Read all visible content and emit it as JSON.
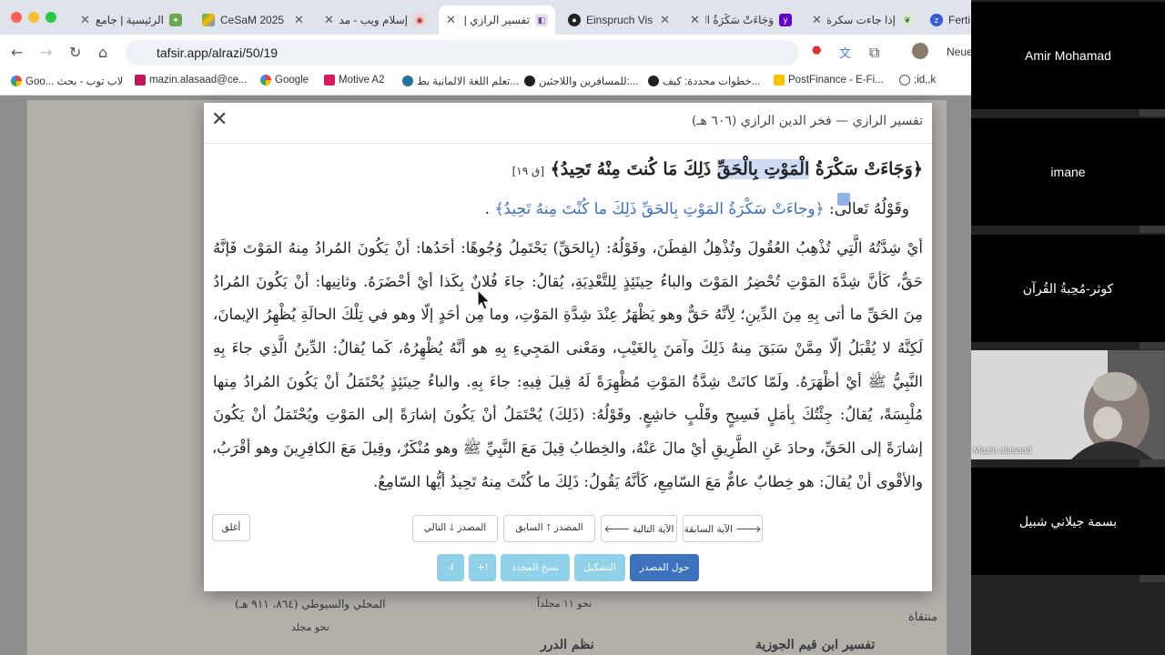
{
  "tabs": [
    {
      "title": "الرئيسية | جامع",
      "icon": "tab-icon-jami"
    },
    {
      "title": "CeSaM 2025",
      "icon": "google-drive-icon"
    },
    {
      "title": "إسلام ويب - مد",
      "icon": "islamweb-icon"
    },
    {
      "title": "تفسير الرازي | 9",
      "icon": "tafsir-icon"
    },
    {
      "title": "Einspruch Vis",
      "icon": "github-icon"
    },
    {
      "title": "وَجَاءَتْ سَكْرَةُ الْ",
      "icon": "yahoo-icon"
    },
    {
      "title": "إذا جاءت سكرة",
      "icon": "leaf-icon"
    },
    {
      "title": "Fertig",
      "icon": "zm-icon"
    }
  ],
  "address_bar": {
    "url": "tafsir.app/alrazi/50/19"
  },
  "profile": {
    "label": "Neue"
  },
  "bookmarks": [
    {
      "label": "Goo... لاب توب - بحث",
      "icon": "google-icon"
    },
    {
      "label": "mazin.alasaad@ce...",
      "icon": "bookmark-icon"
    },
    {
      "label": "Google",
      "icon": "google-icon"
    },
    {
      "label": "Motive A2",
      "icon": "motive-icon"
    },
    {
      "label": "تعلم اللغة الالمانية بط...",
      "icon": "wordpress-icon"
    },
    {
      "label": "للمسافرين واللاجئين:...",
      "icon": "g-icon"
    },
    {
      "label": "خطوات محددة: كيف...",
      "icon": "g-icon"
    },
    {
      "label": "PostFinance - E-Fi...",
      "icon": "postfinance-icon"
    },
    {
      "label": ";id,,k",
      "icon": "globe-icon"
    }
  ],
  "background_page": {
    "item1_title": "المحلي والسيوطي (٨٦٤، ٩١١ هـ)",
    "item1_sub": "نحو مجلد",
    "item2_sub": "نحو ١١ مجلداً",
    "item3_label": "منتقاة",
    "item4_title": "نظم الدرر",
    "item5_title": "تفسير ابن قيم الجوزية"
  },
  "modal": {
    "title": "تفسير الرازي — فخر الدين الرازي (٦٠٦ هـ)",
    "verse_before": "﴿وَجَاءَتْ سَكْرَةُ",
    "verse_highlight": "الْمَوْتِ بِالْحَقِّ",
    "verse_after": "ذَلِكَ مَا كُنتَ مِنْهُ تَحِيدُ﴾",
    "verse_ref": "[ق ١٩]",
    "quote_intro": "وقَوْلُهُ تَعالى:",
    "quote_verse": "﴿وجاءَتْ سَكْرَةُ المَوْتِ بِالحَقِّ ذَلِكَ ما كُنْتَ مِنهُ تَحِيدُ﴾",
    "quote_end": ".",
    "commentary_lines": [
      "أيْ شِدَّتُهُ الَّتِي تُذْهِبُ العُقُولَ وتُذْهِلُ الفِطَنَ، وقَوْلُهُ: (بِالحَقِّ) يَحْتَمِلُ وُجُوهًا: أحَدُها: أنْ يَكُونَ المُرادُ مِنهُ المَوْتَ فَإنَّهُ",
      "حَقٌّ، كَأنَّ شِدَّةَ المَوْتِ تُحْضِرُ المَوْتَ والباءُ حِينَئِذٍ لِلتَّعْدِيَةِ، يُقالُ: جاءَ فُلانٌ بِكَذا أيْ أحْضَرَهُ. وثانِيها: أنْ يَكُونَ المُرادُ",
      "مِنَ الحَقِّ ما أتى بِهِ مِنَ الدِّينِ؛ لِأنَّهُ حَقٌّ وهو يَظْهَرُ عِنْدَ شِدَّةِ المَوْتِ، وما مِن أحَدٍ إلّا وهو في تِلْكَ الحالَةِ يُظْهِرُ الإيمانَ،",
      "لَكِنَّهُ لا يُقْبَلُ إلّا مِمَّنْ سَبَقَ مِنهُ ذَلِكَ وآمَنَ بِالغَيْبِ، ومَعْنى المَجِيءِ بِهِ هو أنَّهُ يُظْهِرُهُ، كَما يُقالُ: الدِّينُ الَّذِي جاءَ بِهِ",
      "النَّبِيُّ ﷺ أيْ أظْهَرَهُ. ولَمّا كانَتْ شِدَّةُ المَوْتِ مُظْهِرَةً لَهُ قِيلَ فِيهِ: جاءَ بِهِ. والباءُ حِينَئِذٍ يُحْتَمَلُ أنْ يَكُونَ المُرادُ مِنها",
      "مُلْبِسَةً، يُقالُ: جِئْتُكَ بِأمَلٍ فَسِيحٍ وقَلْبٍ خاشِعٍ. وقَوْلُهُ: (ذَلِكَ) يُحْتَمَلُ أنْ يَكُونَ إشارَةً إلى المَوْتِ ويُحْتَمَلُ أنْ يَكُونَ",
      "إشارَةً إلى الحَقِّ، وحادَ عَنِ الطَّرِيقِ أيْ مالَ عَنْهُ، والخِطابُ قِيلَ مَعَ النَّبِيِّ ﷺ وهو مُنْكَرٌ، وقِيلَ مَعَ الكافِرِينَ وهو أقْرَبُ،",
      "والأقْوى أنْ يُقالَ: هو خِطابٌ عامٌّ مَعَ السّامِعِ، كَأنَّهُ يَقُولُ: ذَلِكَ ما كُنْتَ مِنهُ تَحِيدُ أيُّها السّامِعُ."
    ],
    "buttons": {
      "prev_ayah": "🡒 الآية السابقة",
      "next_ayah": "الآية التالية 🡐",
      "prev_source": "المصدر 🡑 السابق",
      "next_source": "المصدر 🡓 التالي",
      "close": "أغلق",
      "about_source": "حول المصدر",
      "diacritics": "التشكيل",
      "copy_selected": "نسخ المحدد",
      "font_plus": "ا+",
      "font_minus": "ا-"
    }
  },
  "participants": [
    {
      "name": "Amir Mohamad"
    },
    {
      "name": "imane"
    },
    {
      "name": "كوثر-مُحِبةُ القُرآن"
    },
    {
      "name": "Mazin alasaad",
      "video": true
    },
    {
      "name": "بسمة جيلاني شبيل"
    }
  ]
}
